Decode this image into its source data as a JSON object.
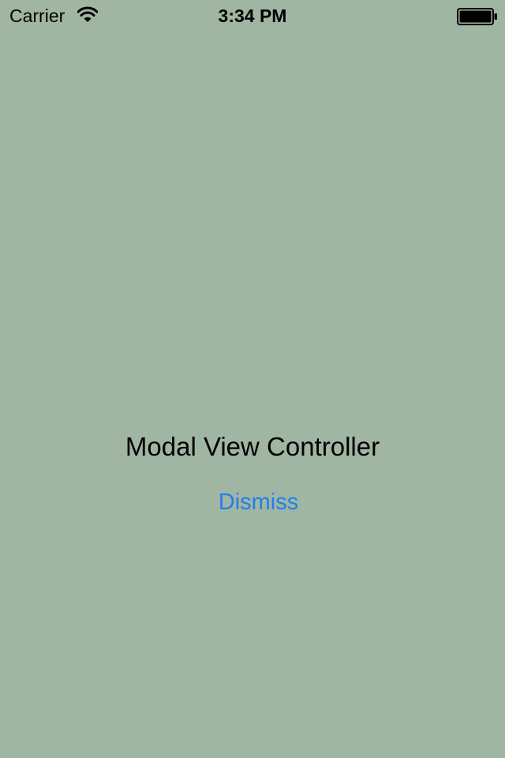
{
  "status_bar": {
    "carrier": "Carrier",
    "time": "3:34 PM",
    "wifi_icon": "wifi-icon",
    "battery_icon": "battery-full-icon"
  },
  "main": {
    "title": "Modal View Controller",
    "dismiss_label": "Dismiss"
  },
  "colors": {
    "background": "#a0b5a2",
    "accent": "#1f7ff0",
    "text": "#000000"
  }
}
